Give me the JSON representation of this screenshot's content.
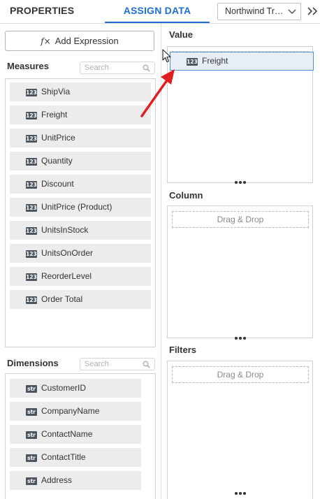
{
  "tabs": {
    "properties": "PROPERTIES",
    "assign_data": "ASSIGN DATA"
  },
  "datasource": {
    "selected": "Northwind Tra..."
  },
  "add_expression": {
    "label": "Add Expression",
    "icon_text": "f×"
  },
  "measures": {
    "title": "Measures",
    "search_placeholder": "Search",
    "badge": "123",
    "items": [
      "ShipVia",
      "Freight",
      "UnitPrice",
      "Quantity",
      "Discount",
      "UnitPrice (Product)",
      "UnitsInStock",
      "UnitsOnOrder",
      "ReorderLevel",
      "Order Total"
    ]
  },
  "dimensions": {
    "title": "Dimensions",
    "search_placeholder": "Search",
    "badge": "str",
    "items": [
      "CustomerID",
      "CompanyName",
      "ContactName",
      "ContactTitle",
      "Address"
    ]
  },
  "value": {
    "title": "Value",
    "dragged_field": "Freight",
    "badge": "123"
  },
  "column": {
    "title": "Column",
    "drop_text": "Drag & Drop"
  },
  "filters": {
    "title": "Filters",
    "drop_text": "Drag & Drop"
  },
  "colors": {
    "accent": "#1e6fd9",
    "arrow": "#e02020",
    "badge_bg": "#4a5560"
  }
}
